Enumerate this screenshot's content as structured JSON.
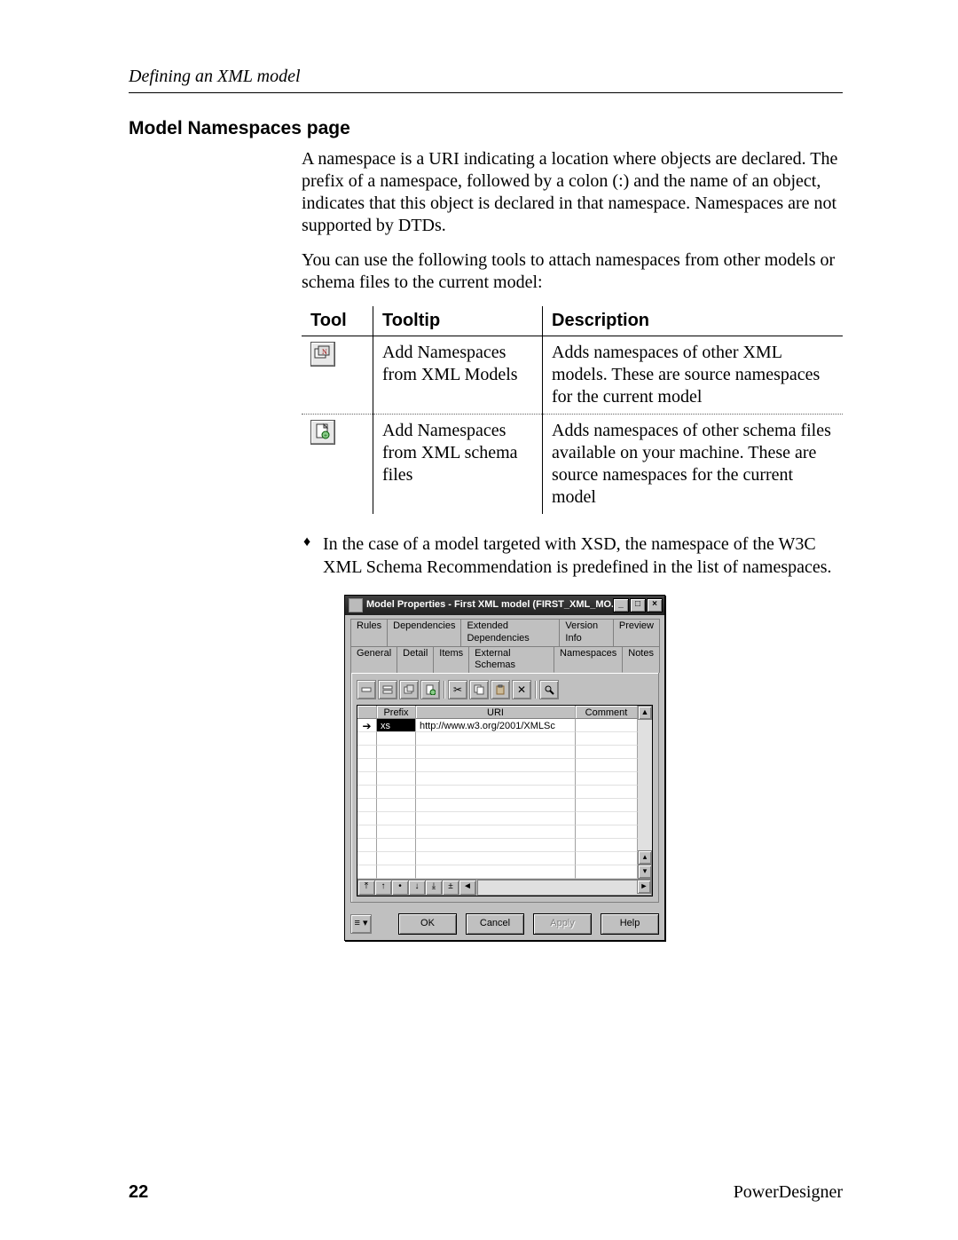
{
  "header": {
    "running_title": "Defining an XML model"
  },
  "section": {
    "title": "Model Namespaces page",
    "para1": "A namespace is a URI indicating a location where objects are declared. The prefix of a namespace, followed by a colon (:) and the name of an object, indicates that this object is declared in that namespace. Namespaces are not supported by DTDs.",
    "para2": "You can use the following tools to attach namespaces from other models or schema files to the current model:"
  },
  "tool_table": {
    "headers": {
      "tool": "Tool",
      "tooltip": "Tooltip",
      "description": "Description"
    },
    "rows": [
      {
        "icon": "add-ns-models-icon",
        "tooltip": "Add Namespaces from XML Models",
        "description": "Adds namespaces of other XML models. These are source namespaces for the current model"
      },
      {
        "icon": "add-ns-schema-icon",
        "tooltip": "Add Namespaces from XML schema files",
        "description": "Adds namespaces of other schema files available on your machine. These are source namespaces for the current model"
      }
    ]
  },
  "bullet": {
    "text": "In the case of a model targeted with XSD, the namespace of the W3C XML Schema Recommendation is predefined in the list of namespaces."
  },
  "dialog": {
    "title": "Model Properties - First XML model (FIRST_XML_MO...",
    "window_buttons": {
      "min": "_",
      "max": "□",
      "close": "×"
    },
    "tabs_row1": [
      "Rules",
      "Dependencies",
      "Extended Dependencies",
      "Version Info",
      "Preview"
    ],
    "tabs_row2": [
      "General",
      "Detail",
      "Items",
      "External Schemas",
      "Namespaces",
      "Notes"
    ],
    "active_tab": "Namespaces",
    "toolbar_icons": [
      "insert-line-icon",
      "add-line-icon",
      "add-ns-models-icon",
      "add-ns-schema-icon",
      "cut-icon",
      "copy-icon",
      "paste-icon",
      "delete-icon",
      "find-icon"
    ],
    "grid": {
      "headers": {
        "prefix": "Prefix",
        "uri": "URI",
        "comment": "Comment"
      },
      "rows": [
        {
          "selected": true,
          "prefix": "xs",
          "uri": "http://www.w3.org/2001/XMLSc",
          "comment": ""
        }
      ],
      "empty_rows": 11
    },
    "nav_buttons": [
      "⤒",
      "↑",
      "•",
      "↓",
      "⤓",
      "±",
      "◄"
    ],
    "buttons": {
      "ok": "OK",
      "cancel": "Cancel",
      "apply": "Apply",
      "help": "Help"
    }
  },
  "footer": {
    "page_number": "22",
    "product": "PowerDesigner"
  }
}
